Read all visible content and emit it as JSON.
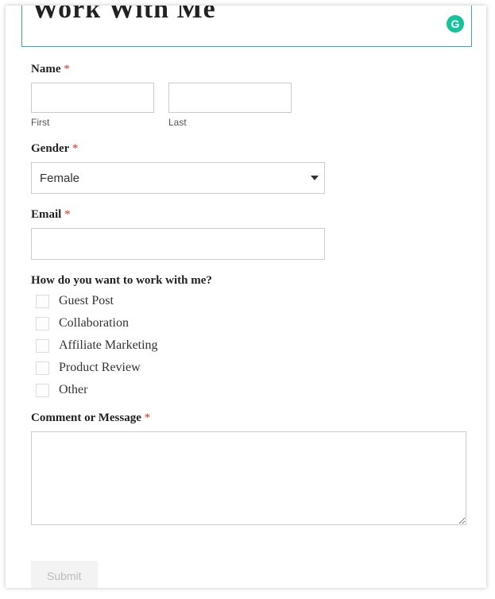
{
  "header": {
    "title": "Work With Me",
    "badge_letter": "G"
  },
  "form": {
    "name": {
      "label": "Name",
      "first_sublabel": "First",
      "last_sublabel": "Last"
    },
    "gender": {
      "label": "Gender",
      "selected": "Female"
    },
    "email": {
      "label": "Email"
    },
    "work_with": {
      "label": "How do you want to work with me?",
      "options": [
        "Guest Post",
        "Collaboration",
        "Affiliate Marketing",
        "Product Review",
        "Other"
      ]
    },
    "message": {
      "label": "Comment or Message"
    },
    "submit_label": "Submit",
    "required_marker": "*"
  }
}
